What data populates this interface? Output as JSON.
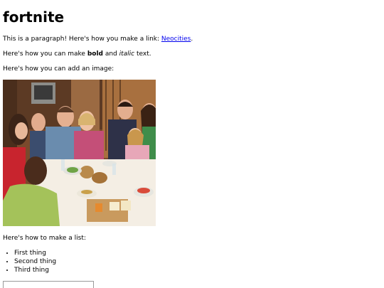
{
  "heading": "fortnite",
  "paragraph1": {
    "prefix": "This is a paragraph! Here's how you make a link: ",
    "link_text": "Neocities",
    "suffix": "."
  },
  "paragraph2": {
    "prefix": "Here's how you can make ",
    "bold_text": "bold",
    "middle": " and ",
    "italic_text": "italic",
    "suffix": " text."
  },
  "paragraph3": "Here's how you can add an image:",
  "image": {
    "subject": "family-dinner-photo"
  },
  "paragraph4": "Here's how to make a list:",
  "list_items": [
    "First thing",
    "Second thing",
    "Third thing"
  ],
  "colors": {
    "link": "#0000ee",
    "text": "#000000",
    "background": "#ffffff"
  }
}
